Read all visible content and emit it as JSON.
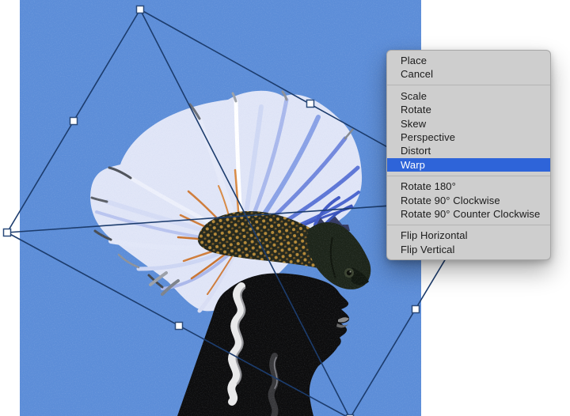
{
  "context_menu": {
    "groups": [
      {
        "items": [
          {
            "label": "Place"
          },
          {
            "label": "Cancel"
          }
        ]
      },
      {
        "items": [
          {
            "label": "Scale"
          },
          {
            "label": "Rotate"
          },
          {
            "label": "Skew"
          },
          {
            "label": "Perspective"
          },
          {
            "label": "Distort"
          },
          {
            "label": "Warp",
            "selected": true
          }
        ]
      },
      {
        "items": [
          {
            "label": "Rotate 180°"
          },
          {
            "label": "Rotate 90° Clockwise"
          },
          {
            "label": "Rotate 90° Counter Clockwise"
          }
        ]
      },
      {
        "items": [
          {
            "label": "Flip Horizontal"
          },
          {
            "label": "Flip Vertical"
          }
        ]
      }
    ]
  },
  "colors": {
    "page_bg": "#ffffff",
    "canvas_blue": "#5c8dd8",
    "menu_bg": "#cecece",
    "menu_text": "#1b1b1b",
    "highlight_blue": "#2e64d9",
    "highlight_text": "#ffffff",
    "separator": "#b3b3b3",
    "transform_line": "#1c3c6d",
    "handle_fill": "#ffffff",
    "handle_border": "#2a4a7a"
  }
}
